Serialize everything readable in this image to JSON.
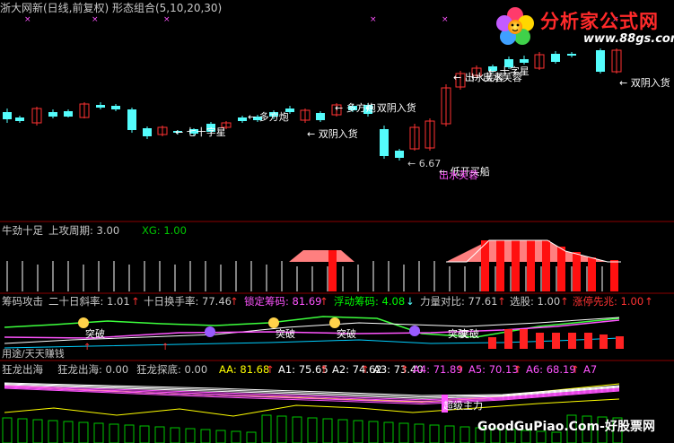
{
  "header": {
    "title": "浙大网新(日线,前复权) 形态组合(5,10,20,30)"
  },
  "logo": {
    "brand": "分析家公式网",
    "url": "www.88gs.com"
  },
  "watermark": "GoodGuPiao.Com-好股票网",
  "colors": {
    "up": "#ff3232",
    "down": "#54fcfc",
    "cross": "#ff54ff",
    "axis": "#8c0000",
    "text": "#c8c8c8",
    "yellow": "#ffff00",
    "green": "#00ff00",
    "magenta": "#ff54ff"
  },
  "chart_data": [
    {
      "type": "candlestick",
      "name": "main",
      "annotations": [
        {
          "text": "七十字星",
          "color": "#ffffff"
        },
        {
          "text": "多方炮",
          "color": "#ffffff"
        },
        {
          "text": "多方炮",
          "color": "#ffffff"
        },
        {
          "text": "双阴入货",
          "color": "#ffffff"
        },
        {
          "text": "双阴入货",
          "color": "#ffffff"
        },
        {
          "text": "6.67",
          "color": "#c8c8c8"
        },
        {
          "text": "低开买船",
          "color": "#ffffff"
        },
        {
          "text": "出水芙蓉",
          "color": "#ffffff"
        },
        {
          "text": "出水芙蓉",
          "color": "#ff54ff"
        },
        {
          "text": "出水芙蓉",
          "color": "#ffffff"
        },
        {
          "text": "十字星",
          "color": "#ffffff"
        },
        {
          "text": "双阴入货",
          "color": "#ffffff"
        }
      ]
    },
    {
      "type": "bar",
      "name": "牛劲十足",
      "labels": [
        {
          "text": "牛劲十足",
          "color": "#c8c8c8"
        },
        {
          "text": "上攻周期: 3.00",
          "color": "#c8c8c8"
        },
        {
          "text": "XG: 1.00",
          "color": "#00c800"
        }
      ]
    },
    {
      "type": "line",
      "name": "筹码攻击",
      "labels": [
        {
          "text": "筹码攻击",
          "color": "#c8c8c8"
        },
        {
          "text": "二十日斜率: 1.01",
          "color": "#c8c8c8"
        },
        {
          "text": "↑",
          "color": "#ff3232"
        },
        {
          "text": "十日换手率: 77.46",
          "color": "#c8c8c8"
        },
        {
          "text": "↑",
          "color": "#ff3232"
        },
        {
          "text": "锁定筹码: 81.69",
          "color": "#ff54ff"
        },
        {
          "text": "↑",
          "color": "#ff3232"
        },
        {
          "text": "浮动筹码: 4.08",
          "color": "#00ff00"
        },
        {
          "text": "↓",
          "color": "#54fcfc"
        },
        {
          "text": "力量对比: 77.61",
          "color": "#c8c8c8"
        },
        {
          "text": "↑",
          "color": "#ff3232"
        },
        {
          "text": "选股: 1.00",
          "color": "#c8c8c8"
        },
        {
          "text": "↑",
          "color": "#ff3232"
        },
        {
          "text": "涨停先兆: 1.00",
          "color": "#ff3232"
        },
        {
          "text": "↑",
          "color": "#ff3232"
        }
      ],
      "markers": [
        "突破",
        "突破",
        "突破",
        "突破",
        "突破"
      ],
      "bottom_label": "用途/天天赚钱"
    },
    {
      "type": "line",
      "name": "狂龙出海",
      "labels": [
        {
          "text": "狂龙出海",
          "color": "#c8c8c8"
        },
        {
          "text": "狂龙出海: 0.00",
          "color": "#c8c8c8"
        },
        {
          "text": "狂龙探底: 0.00",
          "color": "#c8c8c8"
        },
        {
          "text": "AA: 81.68",
          "color": "#ffff00"
        },
        {
          "text": "↑",
          "color": "#ff3232"
        },
        {
          "text": "A1: 75.65",
          "color": "#ffffff"
        },
        {
          "text": "↑",
          "color": "#ff3232"
        },
        {
          "text": "A2: 74.62",
          "color": "#ffffff"
        },
        {
          "text": "↑",
          "color": "#ff3232"
        },
        {
          "text": "A3: 73.40",
          "color": "#ffffff"
        },
        {
          "text": "↑",
          "color": "#ff3232"
        },
        {
          "text": "A4: 71.89",
          "color": "#ff54ff"
        },
        {
          "text": "↑",
          "color": "#ff3232"
        },
        {
          "text": "A5: 70.13",
          "color": "#ff54ff"
        },
        {
          "text": "↑",
          "color": "#ff3232"
        },
        {
          "text": "A6: 68.19",
          "color": "#ff54ff"
        },
        {
          "text": "↑",
          "color": "#ff3232"
        },
        {
          "text": "A7",
          "color": "#ff54ff"
        }
      ],
      "marker": "超级主力"
    }
  ]
}
